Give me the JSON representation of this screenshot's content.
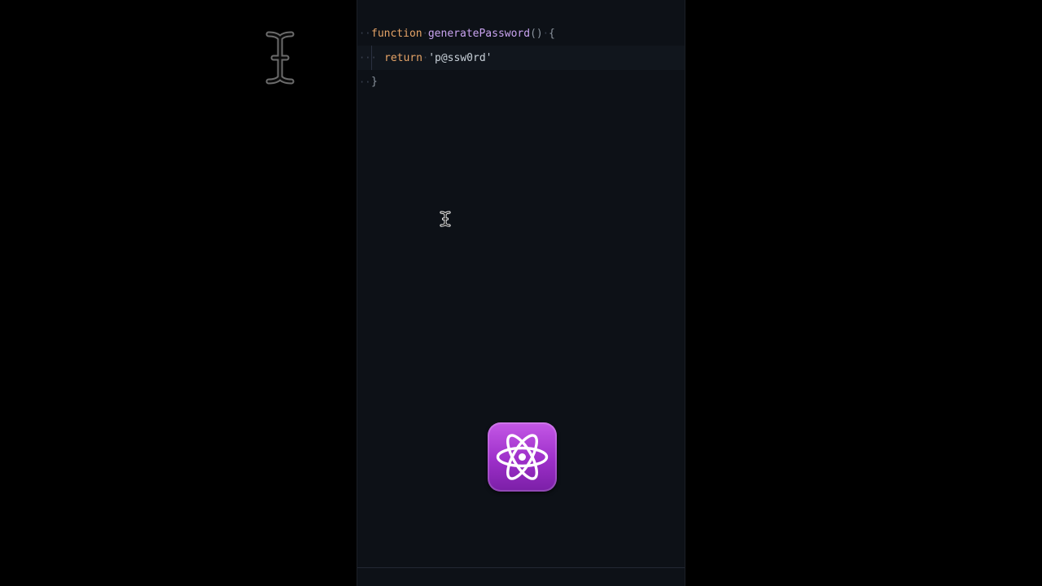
{
  "editor": {
    "lines": [
      {
        "keyword": "function",
        "name": "generatePassword",
        "parens": "()",
        "brace": "{"
      },
      {
        "keyword": "return",
        "string": "'p@ssw0rd'"
      },
      {
        "brace": "}"
      }
    ],
    "whitespace_dots": {
      "line1": "··",
      "line2_a": "···",
      "line2_b": "·",
      "line3": "··",
      "between": "·"
    }
  },
  "overlay": {
    "icon": "atom-icon",
    "cursor_icon": "text-cursor-icon"
  },
  "colors": {
    "background": "#000000",
    "editor_bg": "#0d1117",
    "keyword": "#e6a467",
    "function_name": "#c9a3f0",
    "icon_purple": "#9d2fc9"
  }
}
